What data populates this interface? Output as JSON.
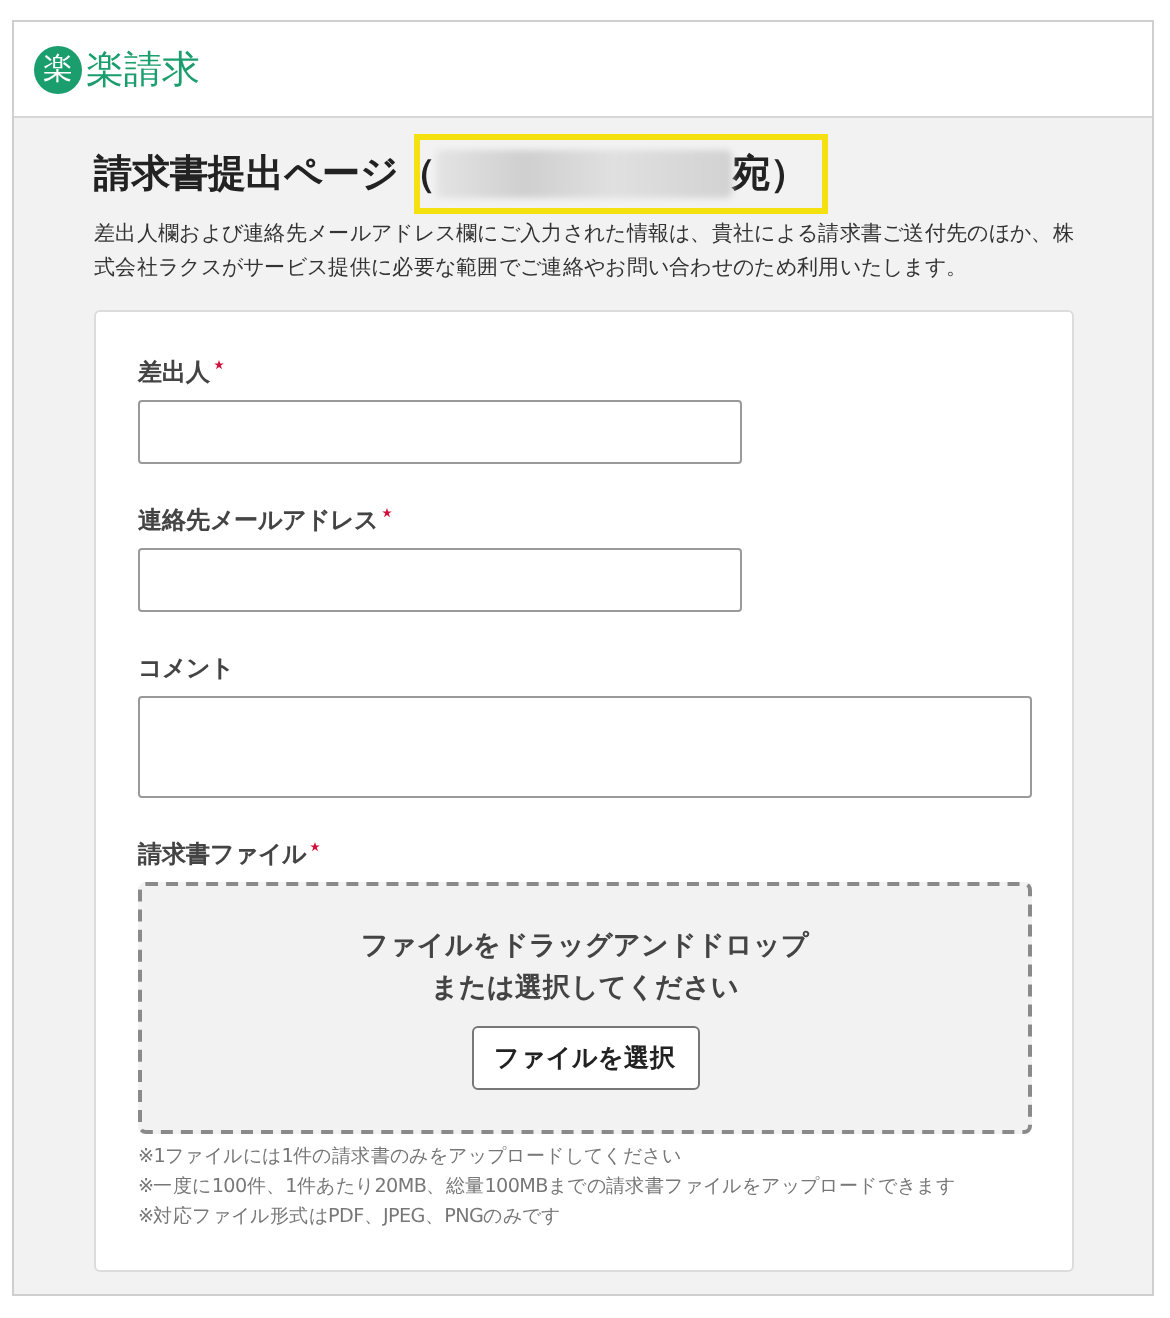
{
  "logo": {
    "mark": "楽",
    "text": "楽請求"
  },
  "heading": {
    "before": "請求書提出ページ（",
    "after": "宛）",
    "redacted": true,
    "highlighted": true
  },
  "notice": "差出人欄および連絡先メールアドレス欄にご入力された情報は、貴社による請求書ご送付先のほか、株式会社ラクスがサービス提供に必要な範囲でご連絡やお問い合わせのため利用いたします。",
  "fields": [
    {
      "label": "差出人",
      "required": true,
      "kind": "text"
    },
    {
      "label": "連絡先メールアドレス",
      "required": true,
      "kind": "text"
    },
    {
      "label": "コメント",
      "required": false,
      "kind": "textarea"
    }
  ],
  "upload": {
    "label": "請求書ファイル",
    "required": true,
    "prompt_lines": [
      "ファイルをドラッグアンドドロップ",
      "または選択してください"
    ],
    "button": "ファイルを選択",
    "notes": [
      "※1ファイルには1件の請求書のみをアップロードしてください",
      "※一度に100件、1件あたり20MB、総量100MBまでの請求書ファイルをアップロードできます",
      "※対応ファイル形式はPDF、JPEG、PNGのみです"
    ]
  }
}
